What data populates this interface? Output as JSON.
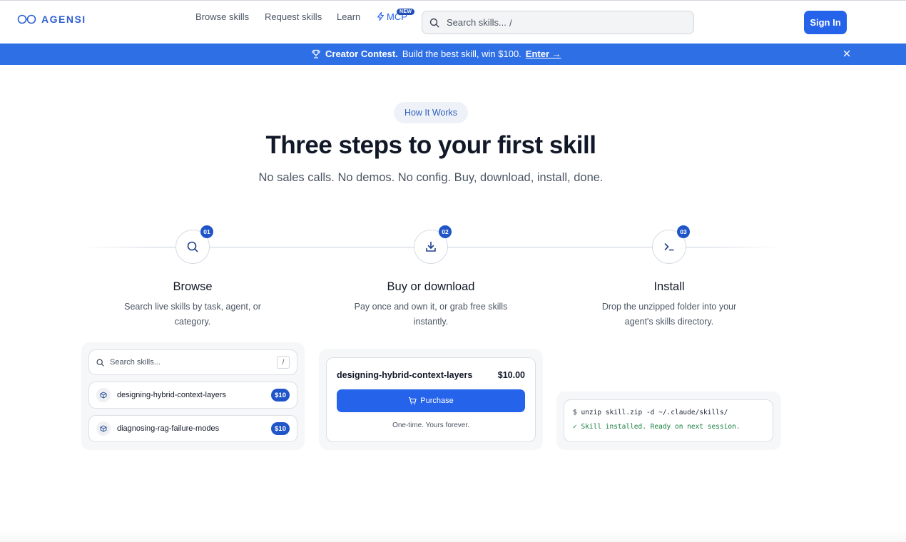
{
  "brand": {
    "name": "AGENSI"
  },
  "nav": {
    "browse": "Browse skills",
    "request": "Request skills",
    "learn": "Learn",
    "mcp": "MCP",
    "mcp_badge": "NEW"
  },
  "search": {
    "placeholder": "Search skills...",
    "shortcut": "/"
  },
  "signin_label": "Sign In",
  "banner": {
    "title": "Creator Contest.",
    "text": "Build the best skill, win $100.",
    "link": "Enter →"
  },
  "hero": {
    "pill": "How It Works",
    "title": "Three steps to your first skill",
    "subtitle": "No sales calls. No demos. No config. Buy, download, install, done."
  },
  "steps": [
    {
      "num": "01",
      "title": "Browse",
      "desc": "Search live skills by task, agent, or category.",
      "icon": "search-icon"
    },
    {
      "num": "02",
      "title": "Buy or download",
      "desc": "Pay once and own it, or grab free skills instantly.",
      "icon": "download-icon"
    },
    {
      "num": "03",
      "title": "Install",
      "desc": "Drop the unzipped folder into your agent's skills directory.",
      "icon": "terminal-icon"
    }
  ],
  "browse_demo": {
    "search_placeholder": "Search skills...",
    "shortcut": "/",
    "items": [
      {
        "name": "designing-hybrid-context-layers",
        "price": "$10"
      },
      {
        "name": "diagnosing-rag-failure-modes",
        "price": "$10"
      }
    ]
  },
  "buy_demo": {
    "name": "designing-hybrid-context-layers",
    "price": "$10.00",
    "button": "Purchase",
    "note": "One-time. Yours forever."
  },
  "install_demo": {
    "command": "$ unzip skill.zip -d ~/.claude/skills/",
    "output": "✓ Skill installed. Ready on next session."
  },
  "colors": {
    "accent": "#2563eb",
    "banner": "#2f6fe6",
    "badge": "#2055c8"
  }
}
